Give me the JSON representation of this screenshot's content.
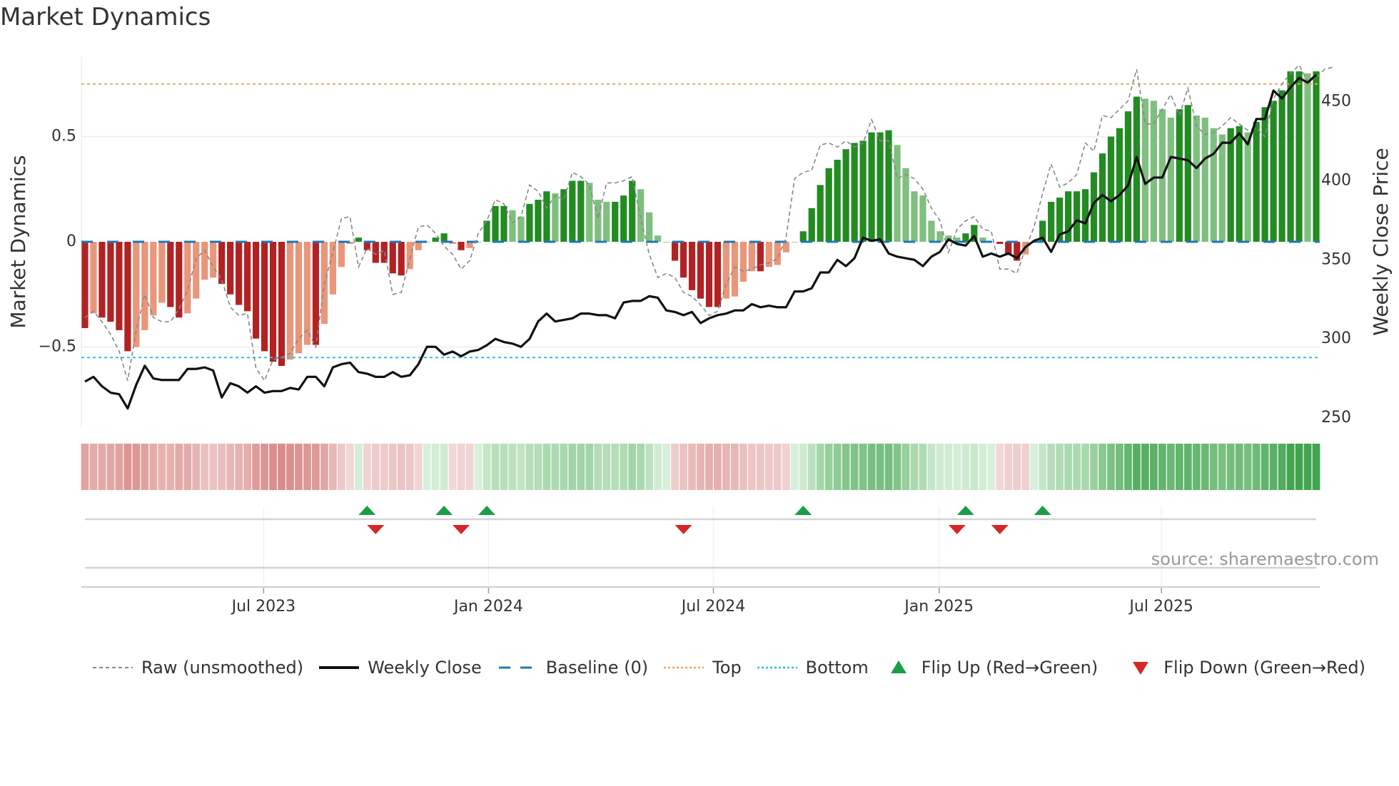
{
  "chart_data": {
    "type": "bar",
    "title": "Market Dynamics",
    "ylabel": "Market Dynamics",
    "ylabel_right": "Weekly Close Price",
    "ylim": [
      -0.72,
      1.0
    ],
    "ylim_right": [
      249,
      476
    ],
    "yticks": [
      {
        "v": 0.5,
        "label": "0.5"
      },
      {
        "v": 0,
        "label": "0"
      },
      {
        "v": -0.5,
        "label": "−0.5"
      }
    ],
    "yticks_right": [
      {
        "v": 450,
        "label": "450"
      },
      {
        "v": 400,
        "label": "400"
      },
      {
        "v": 350,
        "label": "350"
      },
      {
        "v": 300,
        "label": "300"
      },
      {
        "v": 250,
        "label": "250"
      }
    ],
    "xticks": [
      {
        "week": 20.9,
        "label": "Jul 2023"
      },
      {
        "week": 47.2,
        "label": "Jan 2024"
      },
      {
        "week": 73.5,
        "label": "Jul 2024"
      },
      {
        "week": 99.9,
        "label": "Jan 2025"
      },
      {
        "week": 125.9,
        "label": "Jul 2025"
      }
    ],
    "top_level": 0.75,
    "bottom_level": -0.55,
    "baseline": 0,
    "colors": {
      "pos_strong": "#228b22",
      "pos_weak": "#7fbf7f",
      "neg_strong": "#b22222",
      "neg_weak": "#e9967a",
      "raw": "#888888",
      "close": "#111111",
      "baseline": "#1f77b4",
      "top": "#f4a460",
      "bottom": "#22c7d6",
      "flip_up": "#1a9e45",
      "flip_down": "#d62728"
    },
    "smoothed": [
      -0.41,
      -0.34,
      -0.36,
      -0.38,
      -0.42,
      -0.52,
      -0.5,
      -0.42,
      -0.35,
      -0.29,
      -0.31,
      -0.36,
      -0.34,
      -0.27,
      -0.18,
      -0.17,
      -0.2,
      -0.25,
      -0.3,
      -0.33,
      -0.46,
      -0.52,
      -0.57,
      -0.59,
      -0.56,
      -0.53,
      -0.49,
      -0.49,
      -0.39,
      -0.25,
      -0.12,
      -0.01,
      0.02,
      -0.04,
      -0.1,
      -0.1,
      -0.15,
      -0.16,
      -0.13,
      -0.04,
      0.0,
      0.02,
      0.04,
      -0.01,
      -0.04,
      -0.03,
      0.0,
      0.1,
      0.17,
      0.17,
      0.15,
      0.12,
      0.18,
      0.2,
      0.24,
      0.23,
      0.25,
      0.29,
      0.29,
      0.28,
      0.2,
      0.19,
      0.19,
      0.22,
      0.29,
      0.25,
      0.14,
      0.03,
      0.0,
      -0.09,
      -0.17,
      -0.23,
      -0.27,
      -0.31,
      -0.31,
      -0.27,
      -0.26,
      -0.19,
      -0.14,
      -0.14,
      -0.12,
      -0.11,
      -0.05,
      0.0,
      0.05,
      0.16,
      0.27,
      0.35,
      0.39,
      0.44,
      0.47,
      0.48,
      0.52,
      0.52,
      0.53,
      0.46,
      0.35,
      0.24,
      0.22,
      0.1,
      0.05,
      0.03,
      0.02,
      0.04,
      0.08,
      0.02,
      0.0,
      -0.01,
      -0.06,
      -0.09,
      -0.06,
      0.0,
      0.1,
      0.19,
      0.21,
      0.24,
      0.24,
      0.25,
      0.33,
      0.42,
      0.5,
      0.54,
      0.62,
      0.69,
      0.68,
      0.67,
      0.63,
      0.59,
      0.63,
      0.65,
      0.6,
      0.59,
      0.54,
      0.51,
      0.54,
      0.55,
      0.52,
      0.57,
      0.64,
      0.67,
      0.72,
      0.81,
      0.81,
      0.8,
      0.81
    ],
    "raw": [
      -0.36,
      -0.33,
      -0.38,
      -0.44,
      -0.52,
      -0.66,
      -0.42,
      -0.25,
      -0.36,
      -0.38,
      -0.38,
      -0.32,
      -0.23,
      -0.08,
      -0.04,
      -0.12,
      -0.18,
      -0.31,
      -0.35,
      -0.34,
      -0.6,
      -0.66,
      -0.56,
      -0.55,
      -0.53,
      -0.46,
      -0.42,
      -0.5,
      -0.2,
      -0.05,
      0.11,
      0.12,
      -0.12,
      -0.03,
      -0.06,
      -0.04,
      -0.25,
      -0.24,
      -0.08,
      0.07,
      0.08,
      0.04,
      -0.02,
      -0.06,
      -0.13,
      -0.09,
      0.04,
      0.1,
      0.2,
      0.18,
      0.09,
      0.12,
      0.27,
      0.24,
      0.16,
      0.22,
      0.2,
      0.33,
      0.31,
      0.27,
      0.11,
      0.28,
      0.28,
      0.29,
      0.31,
      0.11,
      -0.06,
      -0.17,
      -0.15,
      -0.17,
      -0.24,
      -0.26,
      -0.3,
      -0.35,
      -0.33,
      -0.2,
      -0.12,
      -0.14,
      -0.13,
      -0.11,
      -0.1,
      -0.08,
      0.02,
      0.3,
      0.33,
      0.34,
      0.46,
      0.47,
      0.45,
      0.48,
      0.45,
      0.47,
      0.58,
      0.48,
      0.48,
      0.3,
      0.32,
      0.3,
      0.25,
      0.16,
      0.1,
      -0.05,
      0.06,
      0.1,
      0.12,
      0.06,
      0.05,
      -0.13,
      -0.13,
      -0.15,
      -0.03,
      0.07,
      0.23,
      0.37,
      0.26,
      0.28,
      0.32,
      0.47,
      0.43,
      0.6,
      0.59,
      0.63,
      0.67,
      0.82,
      0.56,
      0.56,
      0.63,
      0.7,
      0.6,
      0.73,
      0.55,
      0.51,
      0.52,
      0.55,
      0.59,
      0.56,
      0.53,
      0.54,
      0.5,
      0.68,
      0.75,
      0.8,
      0.84,
      0.76,
      0.78,
      0.82,
      0.83
    ],
    "close": [
      273,
      276,
      270,
      266,
      265,
      256,
      271,
      283,
      275,
      274,
      274,
      274,
      281,
      281,
      282,
      280,
      263,
      272,
      270,
      266,
      270,
      266,
      267,
      267,
      269,
      268,
      276,
      276,
      270,
      282,
      284,
      285,
      279,
      278,
      276,
      276,
      279,
      276,
      277,
      284,
      295,
      295,
      290,
      292,
      289,
      292,
      293,
      296,
      300,
      298,
      297,
      295,
      300,
      311,
      316,
      311,
      312,
      313,
      316,
      316,
      315,
      315,
      313,
      323,
      324,
      324,
      327,
      326,
      318,
      317,
      315,
      317,
      310,
      313,
      315,
      316,
      318,
      318,
      322,
      320,
      321,
      320,
      320,
      330,
      330,
      332,
      342,
      342,
      350,
      346,
      351,
      364,
      362,
      363,
      354,
      352,
      351,
      350,
      346,
      352,
      355,
      363,
      360,
      359,
      365,
      352,
      354,
      352,
      354,
      351,
      358,
      362,
      364,
      355,
      366,
      368,
      375,
      373,
      386,
      391,
      387,
      391,
      397,
      415,
      398,
      402,
      402,
      415,
      414,
      413,
      408,
      414,
      417,
      424,
      424,
      430,
      423,
      439,
      439,
      457,
      452,
      459,
      465,
      462,
      467
    ],
    "flip_up_weeks": [
      33,
      42,
      47,
      84,
      103,
      112
    ],
    "flip_down_weeks": [
      34,
      44,
      70,
      102,
      107
    ],
    "legend": [
      {
        "key": "raw",
        "label": "Raw (unsmoothed)"
      },
      {
        "key": "close",
        "label": "Weekly Close"
      },
      {
        "key": "baseline",
        "label": "Baseline (0)"
      },
      {
        "key": "top",
        "label": "Top"
      },
      {
        "key": "bottom",
        "label": "Bottom"
      },
      {
        "key": "flip_up",
        "label": "Flip Up (Red→Green)"
      },
      {
        "key": "flip_down",
        "label": "Flip Down (Green→Red)"
      }
    ],
    "legend_position": "bottom",
    "source": "source: sharemaestro.com"
  }
}
